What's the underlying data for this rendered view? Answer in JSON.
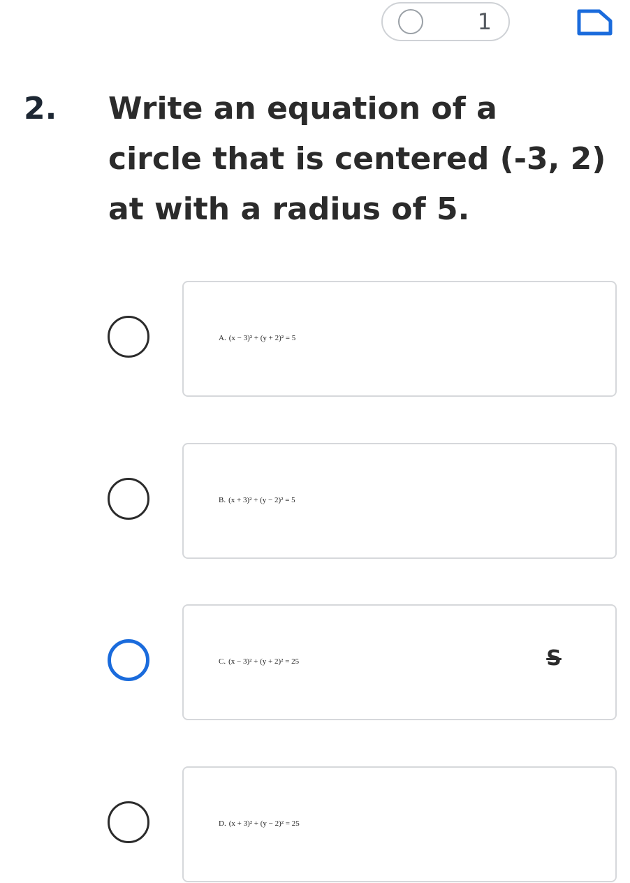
{
  "header": {
    "question_progress_number": "1"
  },
  "question": {
    "number": "2.",
    "lines": [
      "Write an equation of a",
      "circle that is centered (-3, 2)",
      "at with a radius of 5."
    ]
  },
  "options": [
    {
      "letter": "A.",
      "equation": "(x − 3)² + (y + 2)² = 5"
    },
    {
      "letter": "B.",
      "equation": "(x + 3)² + (y − 2)² = 5"
    },
    {
      "letter": "C.",
      "equation": "(x − 3)² + (y + 2)² = 25",
      "eliminate_label": "S"
    },
    {
      "letter": "D.",
      "equation": "(x + 3)² + (y − 2)² = 25"
    }
  ],
  "colors": {
    "accent": "#1a6bdc",
    "text": "#2b2b2b",
    "card_border": "#d6d8db"
  },
  "icons": {
    "progress": "empty-circle-icon",
    "bookmark": "bookmark-flag-icon",
    "eliminate": "strikethrough-icon"
  }
}
